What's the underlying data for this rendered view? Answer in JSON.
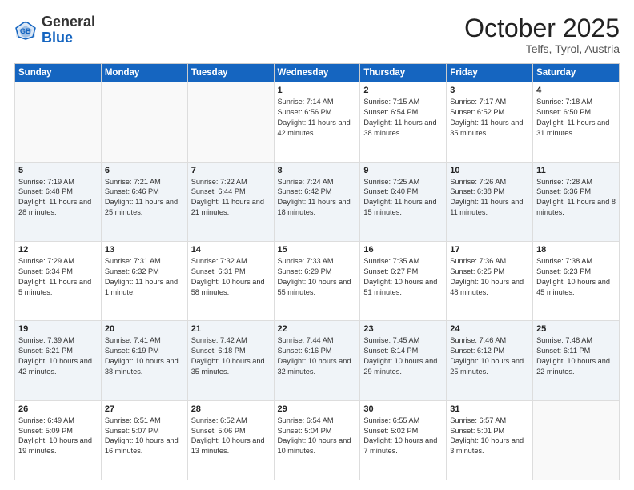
{
  "header": {
    "logo_general": "General",
    "logo_blue": "Blue",
    "month_title": "October 2025",
    "location": "Telfs, Tyrol, Austria"
  },
  "weekdays": [
    "Sunday",
    "Monday",
    "Tuesday",
    "Wednesday",
    "Thursday",
    "Friday",
    "Saturday"
  ],
  "weeks": [
    [
      {
        "day": "",
        "info": ""
      },
      {
        "day": "",
        "info": ""
      },
      {
        "day": "",
        "info": ""
      },
      {
        "day": "1",
        "info": "Sunrise: 7:14 AM\nSunset: 6:56 PM\nDaylight: 11 hours and 42 minutes."
      },
      {
        "day": "2",
        "info": "Sunrise: 7:15 AM\nSunset: 6:54 PM\nDaylight: 11 hours and 38 minutes."
      },
      {
        "day": "3",
        "info": "Sunrise: 7:17 AM\nSunset: 6:52 PM\nDaylight: 11 hours and 35 minutes."
      },
      {
        "day": "4",
        "info": "Sunrise: 7:18 AM\nSunset: 6:50 PM\nDaylight: 11 hours and 31 minutes."
      }
    ],
    [
      {
        "day": "5",
        "info": "Sunrise: 7:19 AM\nSunset: 6:48 PM\nDaylight: 11 hours and 28 minutes."
      },
      {
        "day": "6",
        "info": "Sunrise: 7:21 AM\nSunset: 6:46 PM\nDaylight: 11 hours and 25 minutes."
      },
      {
        "day": "7",
        "info": "Sunrise: 7:22 AM\nSunset: 6:44 PM\nDaylight: 11 hours and 21 minutes."
      },
      {
        "day": "8",
        "info": "Sunrise: 7:24 AM\nSunset: 6:42 PM\nDaylight: 11 hours and 18 minutes."
      },
      {
        "day": "9",
        "info": "Sunrise: 7:25 AM\nSunset: 6:40 PM\nDaylight: 11 hours and 15 minutes."
      },
      {
        "day": "10",
        "info": "Sunrise: 7:26 AM\nSunset: 6:38 PM\nDaylight: 11 hours and 11 minutes."
      },
      {
        "day": "11",
        "info": "Sunrise: 7:28 AM\nSunset: 6:36 PM\nDaylight: 11 hours and 8 minutes."
      }
    ],
    [
      {
        "day": "12",
        "info": "Sunrise: 7:29 AM\nSunset: 6:34 PM\nDaylight: 11 hours and 5 minutes."
      },
      {
        "day": "13",
        "info": "Sunrise: 7:31 AM\nSunset: 6:32 PM\nDaylight: 11 hours and 1 minute."
      },
      {
        "day": "14",
        "info": "Sunrise: 7:32 AM\nSunset: 6:31 PM\nDaylight: 10 hours and 58 minutes."
      },
      {
        "day": "15",
        "info": "Sunrise: 7:33 AM\nSunset: 6:29 PM\nDaylight: 10 hours and 55 minutes."
      },
      {
        "day": "16",
        "info": "Sunrise: 7:35 AM\nSunset: 6:27 PM\nDaylight: 10 hours and 51 minutes."
      },
      {
        "day": "17",
        "info": "Sunrise: 7:36 AM\nSunset: 6:25 PM\nDaylight: 10 hours and 48 minutes."
      },
      {
        "day": "18",
        "info": "Sunrise: 7:38 AM\nSunset: 6:23 PM\nDaylight: 10 hours and 45 minutes."
      }
    ],
    [
      {
        "day": "19",
        "info": "Sunrise: 7:39 AM\nSunset: 6:21 PM\nDaylight: 10 hours and 42 minutes."
      },
      {
        "day": "20",
        "info": "Sunrise: 7:41 AM\nSunset: 6:19 PM\nDaylight: 10 hours and 38 minutes."
      },
      {
        "day": "21",
        "info": "Sunrise: 7:42 AM\nSunset: 6:18 PM\nDaylight: 10 hours and 35 minutes."
      },
      {
        "day": "22",
        "info": "Sunrise: 7:44 AM\nSunset: 6:16 PM\nDaylight: 10 hours and 32 minutes."
      },
      {
        "day": "23",
        "info": "Sunrise: 7:45 AM\nSunset: 6:14 PM\nDaylight: 10 hours and 29 minutes."
      },
      {
        "day": "24",
        "info": "Sunrise: 7:46 AM\nSunset: 6:12 PM\nDaylight: 10 hours and 25 minutes."
      },
      {
        "day": "25",
        "info": "Sunrise: 7:48 AM\nSunset: 6:11 PM\nDaylight: 10 hours and 22 minutes."
      }
    ],
    [
      {
        "day": "26",
        "info": "Sunrise: 6:49 AM\nSunset: 5:09 PM\nDaylight: 10 hours and 19 minutes."
      },
      {
        "day": "27",
        "info": "Sunrise: 6:51 AM\nSunset: 5:07 PM\nDaylight: 10 hours and 16 minutes."
      },
      {
        "day": "28",
        "info": "Sunrise: 6:52 AM\nSunset: 5:06 PM\nDaylight: 10 hours and 13 minutes."
      },
      {
        "day": "29",
        "info": "Sunrise: 6:54 AM\nSunset: 5:04 PM\nDaylight: 10 hours and 10 minutes."
      },
      {
        "day": "30",
        "info": "Sunrise: 6:55 AM\nSunset: 5:02 PM\nDaylight: 10 hours and 7 minutes."
      },
      {
        "day": "31",
        "info": "Sunrise: 6:57 AM\nSunset: 5:01 PM\nDaylight: 10 hours and 3 minutes."
      },
      {
        "day": "",
        "info": ""
      }
    ]
  ]
}
